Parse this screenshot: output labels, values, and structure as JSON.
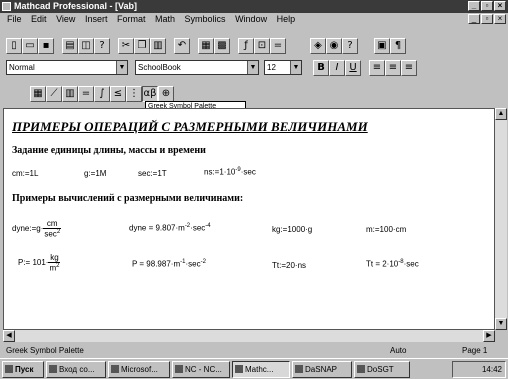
{
  "title": "Mathcad Professional - [Vab]",
  "window_controls": {
    "min": "_",
    "max": "▫",
    "close": "×"
  },
  "menu": [
    "File",
    "Edit",
    "View",
    "Insert",
    "Format",
    "Math",
    "Symbolics",
    "Window",
    "Help"
  ],
  "toolbar_icons": [
    "new-icon",
    "open-icon",
    "save-icon",
    "print-icon",
    "print-preview-icon",
    "spellcheck-icon",
    "cut-icon",
    "copy-icon",
    "paste-icon",
    "undo-icon",
    "insert-graph-icon",
    "insert-matrix-icon",
    "insert-function-icon",
    "insert-unit-icon",
    "calculate-icon",
    "resource-icon",
    "help-icon"
  ],
  "format": {
    "style": "Normal",
    "font": "SchoolBook",
    "size": "12",
    "bold": "B",
    "italic": "I",
    "underline": "U"
  },
  "palette_icons": [
    "calculator-palette-icon",
    "graph-palette-icon",
    "matrix-palette-icon",
    "evaluation-palette-icon",
    "calculus-palette-icon",
    "boolean-palette-icon",
    "programming-palette-icon",
    "greek-palette-icon",
    "symbolic-palette-icon"
  ],
  "tooltip": "Greek Symbol Palette",
  "doc": {
    "heading": "ПРИМЕРЫ ОПЕРАЦИЙ С РАЗМЕРНЫМИ ВЕЛИЧИНАМИ",
    "section1": "Задание единицы длины, массы и времени",
    "defs": [
      {
        "lhs": "cm:=1L"
      },
      {
        "lhs": "g:=1M"
      },
      {
        "lhs": "sec:=1T"
      },
      {
        "lhs": "ns:=1·10",
        "exp": "-9",
        "tail": "·sec"
      }
    ],
    "section2": "Примеры вычислений с размерными величинами:",
    "dyne_def": {
      "lhs": "dyne:=g·",
      "num": "cm",
      "den": "sec",
      "den_exp": "2"
    },
    "dyne_val": {
      "text": "dyne = 9.807·m",
      "e1": "-2",
      "mid": "·sec",
      "e2": "-4"
    },
    "kg": "kg:=1000·g",
    "m": "m:=100·cm",
    "p_def": {
      "lhs": "P:= 101·",
      "num": "kg",
      "den": "m",
      "den_exp": "2"
    },
    "p_val": {
      "text": "P = 98.987·m",
      "e1": "-1",
      "mid": "·sec",
      "e2": "-2"
    },
    "tt": "Tt:=20·ns",
    "tt_val": {
      "text": "Tt = 2·10",
      "e1": "-8",
      "tail": "·sec"
    }
  },
  "status": {
    "left": "Greek Symbol Palette",
    "auto": "Auto",
    "page": "Page 1"
  },
  "taskbar": {
    "start": "Пуск",
    "tasks": [
      "Вход со...",
      "Microsof...",
      "NC - NC...",
      "Mathc...",
      "DaSNAP",
      "DoSGT"
    ],
    "clock": "14:42"
  }
}
